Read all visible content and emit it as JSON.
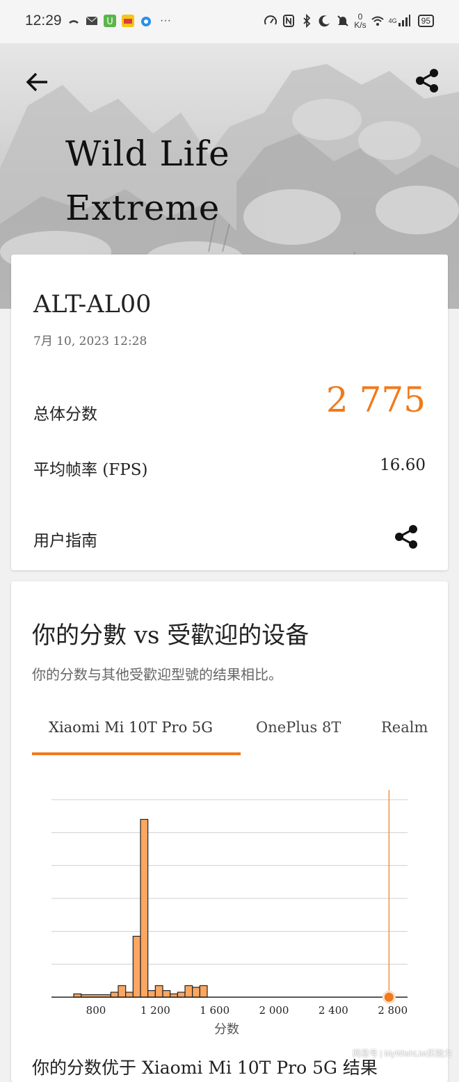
{
  "status_bar": {
    "time": "12:29",
    "network_speed": "0\nK/s",
    "network_type": "4G",
    "battery": "95",
    "overflow": "···"
  },
  "header": {
    "title_line1": "Wild Life",
    "title_line2": "Extreme",
    "back_icon": "back-arrow-icon",
    "share_icon": "share-icon"
  },
  "result": {
    "device_name": "ALT-AL00",
    "date": "7月 10, 2023 12:28",
    "total_score_label": "总体分数",
    "total_score": "2 775",
    "fps_label": "平均帧率 (FPS)",
    "fps_value": "16.60",
    "guide_label": "用户指南",
    "accent_color": "#f07a1c"
  },
  "comparison": {
    "title": "你的分數 vs 受歡迎的设备",
    "subtitle": "你的分数与其他受歡迎型號的结果相比。",
    "tabs": [
      {
        "label": "Xiaomi Mi 10T Pro 5G",
        "selected": true
      },
      {
        "label": "OnePlus 8T",
        "selected": false
      },
      {
        "label": "Realme",
        "selected": false
      }
    ],
    "bottom_text": "你的分数优于 Xiaomi Mi 10T Pro 5G 结果"
  },
  "chart_data": {
    "type": "area",
    "xlabel": "分数",
    "ylabel": "",
    "xlim": [
      500,
      2900
    ],
    "x_ticks": [
      800,
      1200,
      1600,
      2000,
      2400,
      2800
    ],
    "x_tick_labels": [
      "800",
      "1 200",
      "1 600",
      "2 000",
      "2 400",
      "2 800"
    ],
    "grid": true,
    "bins": [
      {
        "x0": 500,
        "x1": 650,
        "value": 0
      },
      {
        "x0": 650,
        "x1": 700,
        "value": 2
      },
      {
        "x0": 700,
        "x1": 900,
        "value": 1.5
      },
      {
        "x0": 900,
        "x1": 950,
        "value": 3
      },
      {
        "x0": 950,
        "x1": 1000,
        "value": 7
      },
      {
        "x0": 1000,
        "x1": 1050,
        "value": 3
      },
      {
        "x0": 1050,
        "x1": 1100,
        "value": 37
      },
      {
        "x0": 1100,
        "x1": 1150,
        "value": 108
      },
      {
        "x0": 1150,
        "x1": 1200,
        "value": 4
      },
      {
        "x0": 1200,
        "x1": 1250,
        "value": 7
      },
      {
        "x0": 1250,
        "x1": 1300,
        "value": 4
      },
      {
        "x0": 1300,
        "x1": 1350,
        "value": 2
      },
      {
        "x0": 1350,
        "x1": 1400,
        "value": 3
      },
      {
        "x0": 1400,
        "x1": 1450,
        "value": 7
      },
      {
        "x0": 1450,
        "x1": 1500,
        "value": 6
      },
      {
        "x0": 1500,
        "x1": 1550,
        "value": 7
      },
      {
        "x0": 1550,
        "x1": 1600,
        "value": 0
      },
      {
        "x0": 1600,
        "x1": 2900,
        "value": 0
      }
    ],
    "ylim": [
      0,
      120
    ],
    "your_score": 2775,
    "fill_color": "#fba661",
    "line_color": "#f07a1c"
  },
  "watermark": "网易号 | MyWishList买微力"
}
